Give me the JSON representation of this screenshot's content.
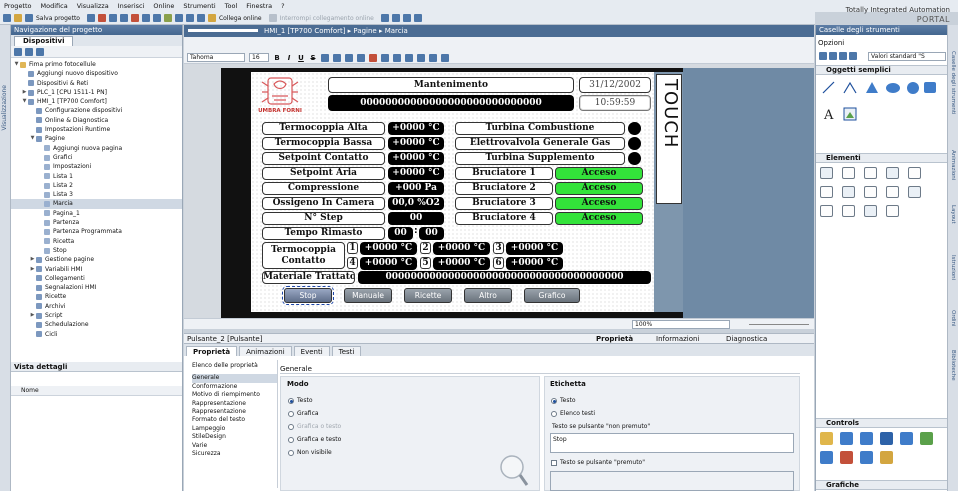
{
  "menu": [
    "Progetto",
    "Modifica",
    "Visualizza",
    "Inserisci",
    "Online",
    "Strumenti",
    "Tool",
    "Finestra",
    "?"
  ],
  "toolbar": {
    "save_label": "Salva progetto",
    "connect_label": "Collega online",
    "disconnect_label": "Interrompi collegamento online"
  },
  "brand": {
    "line1": "Totally Integrated Automation",
    "line2": "PORTAL"
  },
  "left_sidebar_label": "Visualizzazione",
  "project_nav": {
    "title": "Navigazione del progetto",
    "tab": "Dispositivi",
    "tree": [
      {
        "label": "Fima primo fotocellule",
        "level": 0,
        "arrow": "▼"
      },
      {
        "label": "Aggiungi nuovo dispositivo",
        "level": 1,
        "arrow": ""
      },
      {
        "label": "Dispositivi & Reti",
        "level": 1,
        "arrow": ""
      },
      {
        "label": "PLC_1 [CPU 1511-1 PN]",
        "level": 1,
        "arrow": "▶"
      },
      {
        "label": "HMI_1 [TP700 Comfort]",
        "level": 1,
        "arrow": "▼"
      },
      {
        "label": "Configurazione dispositivi",
        "level": 2,
        "arrow": ""
      },
      {
        "label": "Online & Diagnostica",
        "level": 2,
        "arrow": ""
      },
      {
        "label": "Impostazioni Runtime",
        "level": 2,
        "arrow": ""
      },
      {
        "label": "Pagine",
        "level": 2,
        "arrow": "▼"
      },
      {
        "label": "Aggiungi nuova pagina",
        "level": 3,
        "arrow": ""
      },
      {
        "label": "Grafici",
        "level": 3,
        "arrow": ""
      },
      {
        "label": "Impostazioni",
        "level": 3,
        "arrow": ""
      },
      {
        "label": "Lista 1",
        "level": 3,
        "arrow": ""
      },
      {
        "label": "Lista 2",
        "level": 3,
        "arrow": ""
      },
      {
        "label": "Lista 3",
        "level": 3,
        "arrow": ""
      },
      {
        "label": "Marcia",
        "level": 3,
        "arrow": "",
        "selected": true
      },
      {
        "label": "Pagina_1",
        "level": 3,
        "arrow": ""
      },
      {
        "label": "Partenza",
        "level": 3,
        "arrow": ""
      },
      {
        "label": "Partenza Programmata",
        "level": 3,
        "arrow": ""
      },
      {
        "label": "Ricetta",
        "level": 3,
        "arrow": ""
      },
      {
        "label": "Stop",
        "level": 3,
        "arrow": ""
      },
      {
        "label": "Gestione pagine",
        "level": 2,
        "arrow": "▶"
      },
      {
        "label": "Variabili HMI",
        "level": 2,
        "arrow": "▶"
      },
      {
        "label": "Collegamenti",
        "level": 2,
        "arrow": ""
      },
      {
        "label": "Segnalazioni HMI",
        "level": 2,
        "arrow": ""
      },
      {
        "label": "Ricette",
        "level": 2,
        "arrow": ""
      },
      {
        "label": "Archivi",
        "level": 2,
        "arrow": ""
      },
      {
        "label": "Script",
        "level": 2,
        "arrow": "▶"
      },
      {
        "label": "Schedulazione",
        "level": 2,
        "arrow": ""
      },
      {
        "label": "Cicli",
        "level": 2,
        "arrow": ""
      }
    ]
  },
  "details": {
    "title": "Vista dettagli",
    "column": "Nome"
  },
  "editor": {
    "breadcrumb": "HMI_1 [TP700 Comfort]  ▸  Pagine  ▸  Marcia",
    "font": "Tahoma",
    "font_size": "16",
    "zoom": "100%"
  },
  "hmi": {
    "logo_text": "UMBRA FORNI",
    "header_title": "Mantenimento",
    "header_value": "00000000000000000000000000000",
    "date": "31/12/2002",
    "time": "10:59:59",
    "touch": "TOUCH",
    "rows_left": [
      {
        "label": "Termocoppia Alta",
        "value": "+0000 °C"
      },
      {
        "label": "Termocoppia Bassa",
        "value": "+0000 °C"
      },
      {
        "label": "Setpoint Contatto",
        "value": "+0000 °C"
      },
      {
        "label": "Setpoint Aria",
        "value": "+0000 °C"
      },
      {
        "label": "Compressione",
        "value": "+000 Pa"
      },
      {
        "label": "Ossigeno In Camera",
        "value": "00,0 %O2"
      },
      {
        "label": "N° Step",
        "value": "00"
      }
    ],
    "rows_right_ind": [
      "Turbina Combustione",
      "Elettrovalvola Generale Gas",
      "Turbina Supplemento"
    ],
    "rows_right_acc": [
      {
        "label": "Bruciatore 1",
        "state": "Acceso"
      },
      {
        "label": "Bruciatore 2",
        "state": "Acceso"
      },
      {
        "label": "Bruciatore 3",
        "state": "Acceso"
      },
      {
        "label": "Bruciatore 4",
        "state": "Acceso"
      }
    ],
    "tempo_label": "Tempo Rimasto",
    "tempo_h": "00",
    "tempo_sep": ":",
    "tempo_m": "00",
    "tc_label1": "Termocoppia",
    "tc_label2": "Contatto",
    "tc": [
      {
        "n": "1",
        "v": "+0000 °C"
      },
      {
        "n": "2",
        "v": "+0000 °C"
      },
      {
        "n": "3",
        "v": "+0000 °C"
      },
      {
        "n": "4",
        "v": "+0000 °C"
      },
      {
        "n": "5",
        "v": "+0000 °C"
      },
      {
        "n": "6",
        "v": "+0000 °C"
      }
    ],
    "materiale_label": "Materiale Trattato",
    "materiale_value": "00000000000000000000000000000000000000",
    "buttons": [
      "Stop",
      "Manuale",
      "Ricette",
      "Altro",
      "Grafico"
    ],
    "accent_green": "#33e33a"
  },
  "inspector": {
    "title": "Pulsante_2 [Pulsante]",
    "right_tabs": [
      "Proprietà",
      "Informazioni",
      "Diagnostica"
    ],
    "tabs": [
      "Proprietà",
      "Animazioni",
      "Eventi",
      "Testi"
    ],
    "nav_title": "Elenco delle proprietà",
    "nav": [
      "Generale",
      "Conformazione",
      "Motivo di riempimento",
      "Rappresentazione",
      "Rappresentazione",
      "Formato del testo",
      "Lampeggio",
      "StileDesign",
      "Varie",
      "Sicurezza"
    ],
    "section": "Generale",
    "modo_title": "Modo",
    "modo_opts": [
      "Testo",
      "Grafica",
      "Grafica o testo",
      "Grafica e testo",
      "Non visibile"
    ],
    "etichetta_title": "Etichetta",
    "etichetta_opts": [
      "Testo",
      "Elenco testi"
    ],
    "label_non_premuto": "Testo se pulsante \"non premuto\"",
    "value_non_premuto": "Stop",
    "label_premuto": "Testo se pulsante \"premuto\""
  },
  "toolbox": {
    "title": "Caselle degli strumenti",
    "options": "Opzioni",
    "view_select": "Valori standard \"S",
    "sections": [
      "Oggetti semplici",
      "Elementi",
      "Controls",
      "Grafiche"
    ]
  },
  "right_sidebar": [
    "Caselle degli strumenti",
    "Animazioni",
    "Layout",
    "Istruzioni",
    "Ordini",
    "Biblioteche"
  ]
}
